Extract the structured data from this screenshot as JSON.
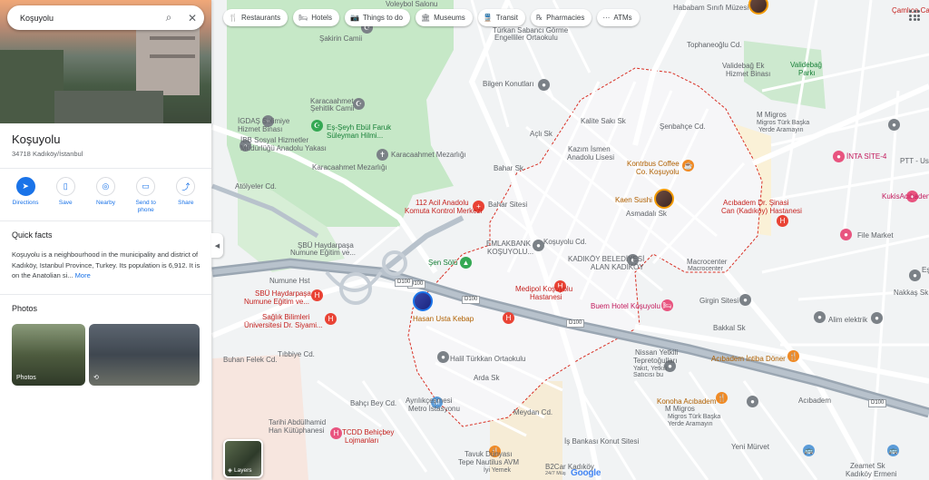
{
  "search": {
    "query": "Koşuyolu"
  },
  "chips": [
    {
      "icon": "restaurant-icon",
      "label": "Restaurants"
    },
    {
      "icon": "hotel-icon",
      "label": "Hotels"
    },
    {
      "icon": "camera-icon",
      "label": "Things to do"
    },
    {
      "icon": "museum-icon",
      "label": "Museums"
    },
    {
      "icon": "transit-icon",
      "label": "Transit"
    },
    {
      "icon": "pharmacy-icon",
      "label": "Pharmacies"
    },
    {
      "icon": "atm-icon",
      "label": "ATMs"
    }
  ],
  "place": {
    "title": "Koşuyolu",
    "address": "34718 Kadıköy/İstanbul",
    "actions": [
      {
        "icon": "directions-icon",
        "label": "Directions"
      },
      {
        "icon": "save-icon",
        "label": "Save"
      },
      {
        "icon": "nearby-icon",
        "label": "Nearby"
      },
      {
        "icon": "send-to-phone-icon",
        "label": "Send to phone"
      },
      {
        "icon": "share-icon",
        "label": "Share"
      }
    ],
    "quick_facts_heading": "Quick facts",
    "quick_facts_text": "Koşuyolu is a neighbourhood in the municipality and district of Kadıköy, Istanbul Province, Turkey. Its population is 6,912. It is on the Anatolian si...",
    "quick_facts_more": "More",
    "photos_heading": "Photos",
    "photos": [
      {
        "caption": "Photos"
      },
      {
        "caption": ""
      }
    ]
  },
  "map": {
    "layers_label": "Layers",
    "logo": "Google",
    "attribution": "24/7 Müş",
    "road_shields": [
      "D100",
      "D100",
      "D100",
      "D100",
      "D100"
    ],
    "labels": [
      {
        "text": "Voleybol Salonu",
        "cls": ""
      },
      {
        "text": "Hababam Sınıfı Müzesi",
        "cls": ""
      },
      {
        "text": "Çamlıca Ca",
        "cls": "red"
      },
      {
        "text": "Şakirin Camii",
        "cls": ""
      },
      {
        "text": "Türkan Sabancı Görme",
        "cls": ""
      },
      {
        "text": "Engelliler Ortaokulu",
        "cls": ""
      },
      {
        "text": "Validebağ Ek",
        "cls": ""
      },
      {
        "text": "Hizmet Binası",
        "cls": ""
      },
      {
        "text": "Validebağ",
        "cls": "green"
      },
      {
        "text": "Parkı",
        "cls": "green"
      },
      {
        "text": "Bilgen Konutları",
        "cls": ""
      },
      {
        "text": "Karacaahmet",
        "cls": ""
      },
      {
        "text": "Şehitlik Camii",
        "cls": ""
      },
      {
        "text": "İGDAŞ Selimiye",
        "cls": ""
      },
      {
        "text": "Hizmet Binası",
        "cls": ""
      },
      {
        "text": "Eş-Şeyh Ebül Faruk",
        "cls": "green"
      },
      {
        "text": "Süleyman Hilmi...",
        "cls": "green"
      },
      {
        "text": "Karacaahmet Mezarlığı",
        "cls": ""
      },
      {
        "text": "M Migros",
        "cls": ""
      },
      {
        "text": "Migros Türk Başka",
        "cls": "sm"
      },
      {
        "text": "Yerde Aramayın",
        "cls": "sm"
      },
      {
        "text": "Kazım İsmen",
        "cls": ""
      },
      {
        "text": "Anadolu Lisesi",
        "cls": ""
      },
      {
        "text": "İBB Sosyal Hizmetler",
        "cls": ""
      },
      {
        "text": "Müdürlüğü Anadolu Yakası",
        "cls": ""
      },
      {
        "text": "Kontrbus Coffee",
        "cls": "orange"
      },
      {
        "text": "Co. Koşuyolu",
        "cls": "orange"
      },
      {
        "text": "İNTA SİTE-4",
        "cls": "pink"
      },
      {
        "text": "PTT - Usk",
        "cls": ""
      },
      {
        "text": "Atölyeler Cd.",
        "cls": ""
      },
      {
        "text": "Kaen Sushi",
        "cls": "orange"
      },
      {
        "text": "Acıbadem Dr. Şinasi",
        "cls": "red"
      },
      {
        "text": "Can (Kadıköy) Hastanesi",
        "cls": "red"
      },
      {
        "text": "KukisAcıbaden",
        "cls": "pink"
      },
      {
        "text": "112 Acil Anadolu",
        "cls": "red"
      },
      {
        "text": "Komuta Kontrol Merkezi",
        "cls": "red"
      },
      {
        "text": "Bahar Sitesi",
        "cls": ""
      },
      {
        "text": "ŞBÜ Haydarpaşa",
        "cls": ""
      },
      {
        "text": "Numune Eğitim ve...",
        "cls": ""
      },
      {
        "text": "EMLAKBANK",
        "cls": ""
      },
      {
        "text": "KOŞUYOLU...",
        "cls": ""
      },
      {
        "text": "Şen Sölü",
        "cls": "green"
      },
      {
        "text": "KADIKÖY BELEDİYESİ",
        "cls": ""
      },
      {
        "text": "ALAN KADIKÖY",
        "cls": ""
      },
      {
        "text": "File Market",
        "cls": ""
      },
      {
        "text": "Macrocenter",
        "cls": ""
      },
      {
        "text": "Macrocenter",
        "cls": "sm"
      },
      {
        "text": "Eşgioğlu Sitesi",
        "cls": ""
      },
      {
        "text": "Numune Hst",
        "cls": ""
      },
      {
        "text": "Medipol Koşuyolu",
        "cls": "red"
      },
      {
        "text": "Hastanesi",
        "cls": "red"
      },
      {
        "text": "SBÜ Haydarpaşa",
        "cls": "red"
      },
      {
        "text": "Numune Eğitim ve...",
        "cls": "red"
      },
      {
        "text": "Girgin Sitesi",
        "cls": ""
      },
      {
        "text": "Buem Hotel Koşuyolu",
        "cls": "pink"
      },
      {
        "text": "Sağlık Bilimleri",
        "cls": "red"
      },
      {
        "text": "Üniversitesi Dr. Siyami...",
        "cls": "red"
      },
      {
        "text": "Hasan Usta Kebap",
        "cls": "orange"
      },
      {
        "text": "Alim elektrik",
        "cls": ""
      },
      {
        "text": "Halil Türkkan Ortaokulu",
        "cls": ""
      },
      {
        "text": "Nissan Yetkili",
        "cls": ""
      },
      {
        "text": "Tepretoğulları",
        "cls": ""
      },
      {
        "text": "Yakıt, Yetkili",
        "cls": "sm"
      },
      {
        "text": "Satıcısı bu",
        "cls": "sm"
      },
      {
        "text": "Acıbadem İntiba Döner",
        "cls": "orange"
      },
      {
        "text": "Acıbadem",
        "cls": ""
      },
      {
        "text": "Ayrılıkçeşmesi",
        "cls": ""
      },
      {
        "text": "Metro İstasyonu",
        "cls": ""
      },
      {
        "text": "Konoha Acıbadem",
        "cls": "orange"
      },
      {
        "text": "M Migros",
        "cls": ""
      },
      {
        "text": "Migros Türk Başka",
        "cls": "sm"
      },
      {
        "text": "Yerde Aramayın",
        "cls": "sm"
      },
      {
        "text": "Tarihi Abdülhamid",
        "cls": ""
      },
      {
        "text": "Han Kütüphanesi",
        "cls": ""
      },
      {
        "text": "TCDD Behiçbey",
        "cls": "red"
      },
      {
        "text": "Lojmanları",
        "cls": "red"
      },
      {
        "text": "Tavuk Dünyası",
        "cls": ""
      },
      {
        "text": "Tepe Nautilus AVM",
        "cls": ""
      },
      {
        "text": "İyi Yemek",
        "cls": "sm"
      },
      {
        "text": "İş Bankası Konut Sitesi",
        "cls": ""
      },
      {
        "text": "B2Car Kadıköy",
        "cls": ""
      },
      {
        "text": "Kadıköy Ermeni",
        "cls": ""
      },
      {
        "text": "Zeamet Sk",
        "cls": ""
      },
      {
        "text": "Buhan Felek Cd.",
        "cls": ""
      },
      {
        "text": "Tıbbiye Cd.",
        "cls": ""
      },
      {
        "text": "Bahçı Bey Cd.",
        "cls": ""
      },
      {
        "text": "Meydan Cd.",
        "cls": ""
      },
      {
        "text": "Arda Sk",
        "cls": ""
      },
      {
        "text": "Bakkal Sk",
        "cls": ""
      },
      {
        "text": "Asmadalı Sk",
        "cls": ""
      },
      {
        "text": "Koşuyolu Cd.",
        "cls": ""
      },
      {
        "text": "Karacaahmet Mezarlığı",
        "cls": ""
      },
      {
        "text": "Şenbahçe Cd.",
        "cls": ""
      },
      {
        "text": "Kalite Sakı Sk",
        "cls": ""
      },
      {
        "text": "Açlı Sk",
        "cls": ""
      },
      {
        "text": "Bahar Sk",
        "cls": ""
      },
      {
        "text": "Tophaneoğlu Cd.",
        "cls": ""
      },
      {
        "text": "Nakkaş Sk",
        "cls": ""
      },
      {
        "text": "Yeni Mürvet",
        "cls": ""
      }
    ]
  }
}
